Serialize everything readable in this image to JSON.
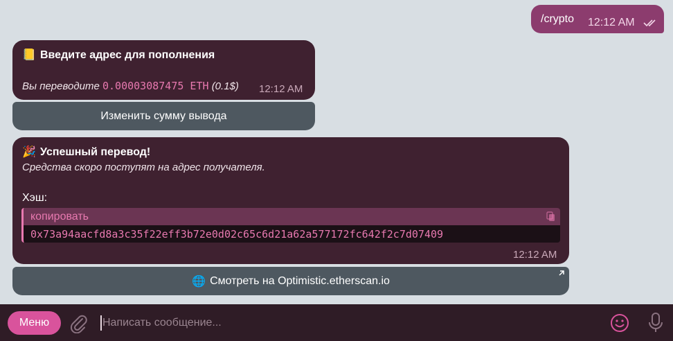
{
  "outgoing": {
    "text": "/crypto",
    "time": "12:12 AM"
  },
  "msg1": {
    "emoji": "📒",
    "title": "Введите адрес для пополнения",
    "line_prefix": "Вы переводите",
    "amount": "0.00003087475 ETH",
    "usd": "(0.1$)",
    "time": "12:12 AM",
    "button": "Изменить сумму вывода"
  },
  "msg2": {
    "emoji": "🎉",
    "title": "Успешный перевод!",
    "subtitle": "Средства скоро поступят на адрес получателя.",
    "hash_label": "Хэш:",
    "copy_label": "копировать",
    "hash": "0x73a94aacfd8a3c35f22eff3b72e0d02c65c6d21a62a577172fc642f2c7d07409",
    "time": "12:12 AM",
    "button_emoji": "🌐",
    "button": "Смотреть на Optimistic.etherscan.io"
  },
  "input": {
    "menu_label": "Меню",
    "placeholder": "Написать сообщение..."
  },
  "colors": {
    "accent": "#d9539c",
    "code": "#e879b0",
    "bubble": "#3f2130",
    "outgoing": "#8c3c6e",
    "button": "#4e5860"
  },
  "icons": [
    "double-check-icon",
    "copy-icon",
    "external-link-icon",
    "paperclip-icon",
    "smile-icon",
    "microphone-icon"
  ]
}
